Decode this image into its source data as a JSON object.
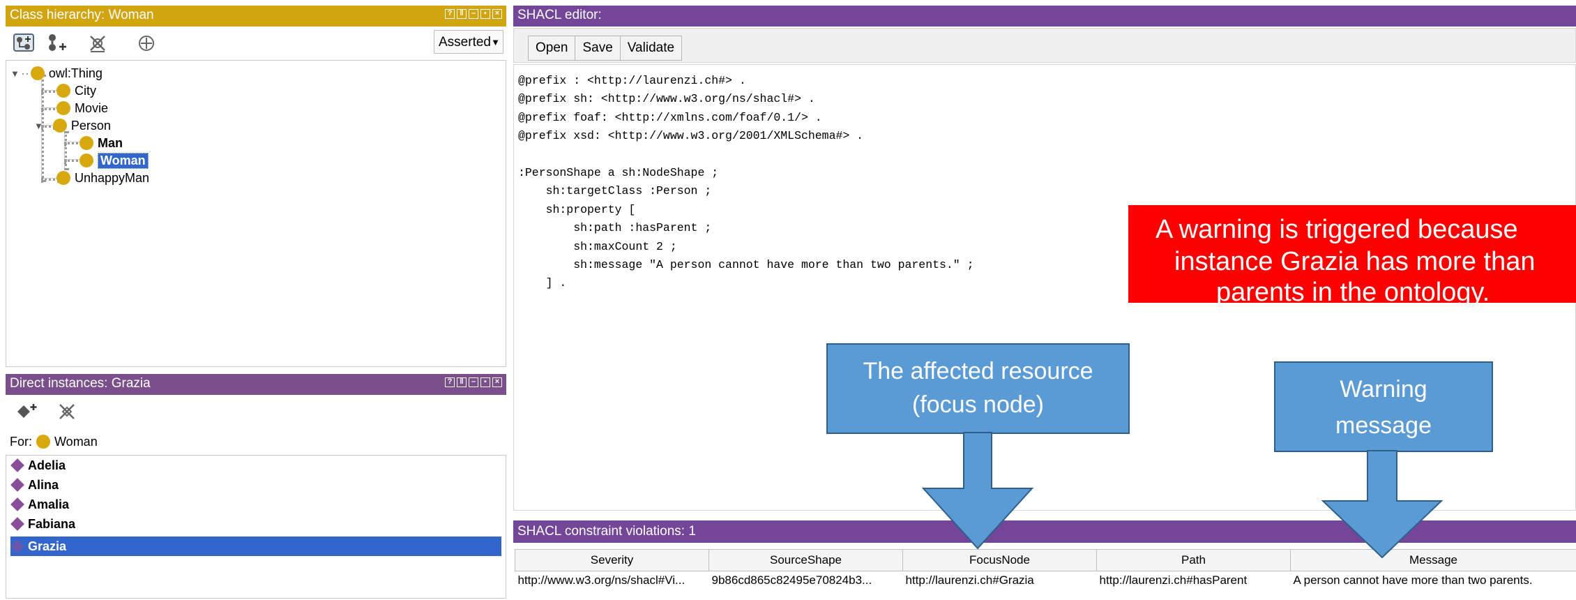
{
  "class_hierarchy": {
    "title": "Class hierarchy: Woman",
    "dropdown": "Asserted",
    "tree": [
      {
        "label": "owl:Thing",
        "bold": false,
        "selected": false
      },
      {
        "label": "City",
        "bold": false,
        "selected": false
      },
      {
        "label": "Movie",
        "bold": false,
        "selected": false
      },
      {
        "label": "Person",
        "bold": false,
        "selected": false
      },
      {
        "label": "Man",
        "bold": true,
        "selected": false
      },
      {
        "label": "Woman",
        "bold": true,
        "selected": true
      },
      {
        "label": "UnhappyMan",
        "bold": false,
        "selected": false
      }
    ]
  },
  "instances": {
    "title": "Direct instances: Grazia",
    "for_label": "For:",
    "for_value": "Woman",
    "items": [
      "Adelia",
      "Alina",
      "Amalia",
      "Fabiana",
      "Grazia"
    ],
    "selected_index": 4
  },
  "shacl_editor": {
    "title": "SHACL editor:",
    "buttons": {
      "open": "Open",
      "save": "Save",
      "validate": "Validate"
    },
    "code": "@prefix : <http://laurenzi.ch#> .\n@prefix sh: <http://www.w3.org/ns/shacl#> .\n@prefix foaf: <http://xmlns.com/foaf/0.1/> .\n@prefix xsd: <http://www.w3.org/2001/XMLSchema#> .\n\n:PersonShape a sh:NodeShape ;\n    sh:targetClass :Person ;\n    sh:property [\n        sh:path :hasParent ;\n        sh:maxCount 2 ;\n        sh:message \"A person cannot have more than two parents.\" ;\n    ] ."
  },
  "violations": {
    "title": "SHACL constraint violations: 1",
    "columns": [
      "Severity",
      "SourceShape",
      "FocusNode",
      "Path",
      "Message"
    ],
    "rows": [
      [
        "http://www.w3.org/ns/shacl#Vi...",
        "9b86cd865c82495e70824b3...",
        "http://laurenzi.ch#Grazia",
        "http://laurenzi.ch#hasParent",
        "A person cannot have more than two parents."
      ]
    ]
  },
  "annotations": {
    "warning_banner": [
      "A warning is triggered because",
      "instance Grazia has more than",
      "parents in the ontology."
    ],
    "focus_callout": [
      "The affected resource",
      "(focus node)"
    ],
    "message_callout": [
      "Warning",
      "message"
    ]
  },
  "colors": {
    "class_title": "#d2a410",
    "instances_title": "#7b4f8c",
    "shacl_title": "#74469a",
    "selection": "#3366cc",
    "callout": "#5b9bd5",
    "warning": "#ff0000",
    "class_dot": "#d8a90f",
    "individual_diamond": "#8a4d9a"
  },
  "icons": [
    "add-subclass-icon",
    "add-sibling-icon",
    "delete-class-icon",
    "target-icon",
    "add-individual-icon",
    "delete-individual-icon",
    "help-icon",
    "split-icon",
    "minimize-icon",
    "maximize-icon",
    "close-icon"
  ]
}
